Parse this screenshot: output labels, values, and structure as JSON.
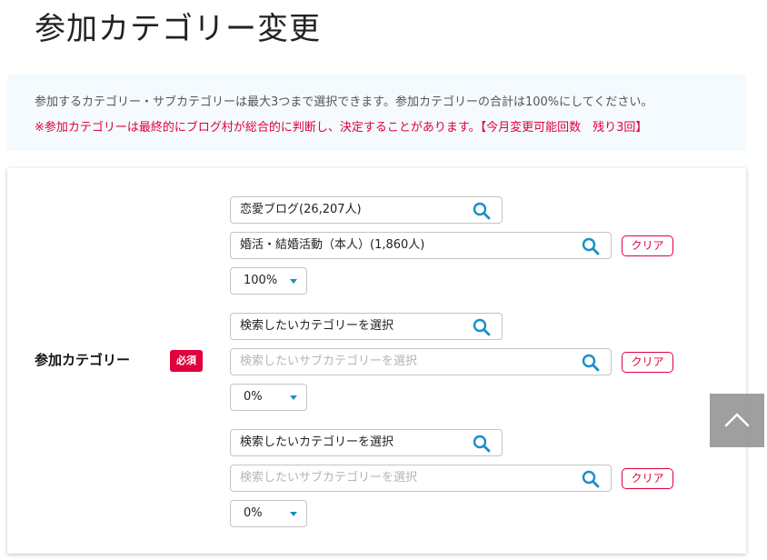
{
  "page": {
    "title": "参加カテゴリー変更"
  },
  "info": {
    "line1": "参加するカテゴリー・サブカテゴリーは最大3つまで選択できます。参加カテゴリーの合計は100%にしてください。",
    "line2": "※参加カテゴリーは最終的にブログ村が総合的に判断し、決定することがあります。【今月変更可能回数　残り3回】"
  },
  "form": {
    "label": "参加カテゴリー",
    "required_badge": "必須",
    "clear_label": "クリア",
    "groups": [
      {
        "category": "恋愛ブログ(26,207人)",
        "subcategory": "婚活・結婚活動（本人）(1,860人)",
        "percent": "100%"
      },
      {
        "category": "検索したいカテゴリーを選択",
        "subcategory_placeholder": "検索したいサブカテゴリーを選択",
        "percent": "0%"
      },
      {
        "category": "検索したいカテゴリーを選択",
        "subcategory_placeholder": "検索したいサブカテゴリーを選択",
        "percent": "0%"
      }
    ]
  },
  "colors": {
    "accent": "#e0003c",
    "icon": "#1a8ec9",
    "info_bg": "#f4fafd"
  },
  "icons": {
    "search": "search-icon",
    "caret": "caret-down-icon",
    "back_to_top": "chevron-up-icon"
  }
}
